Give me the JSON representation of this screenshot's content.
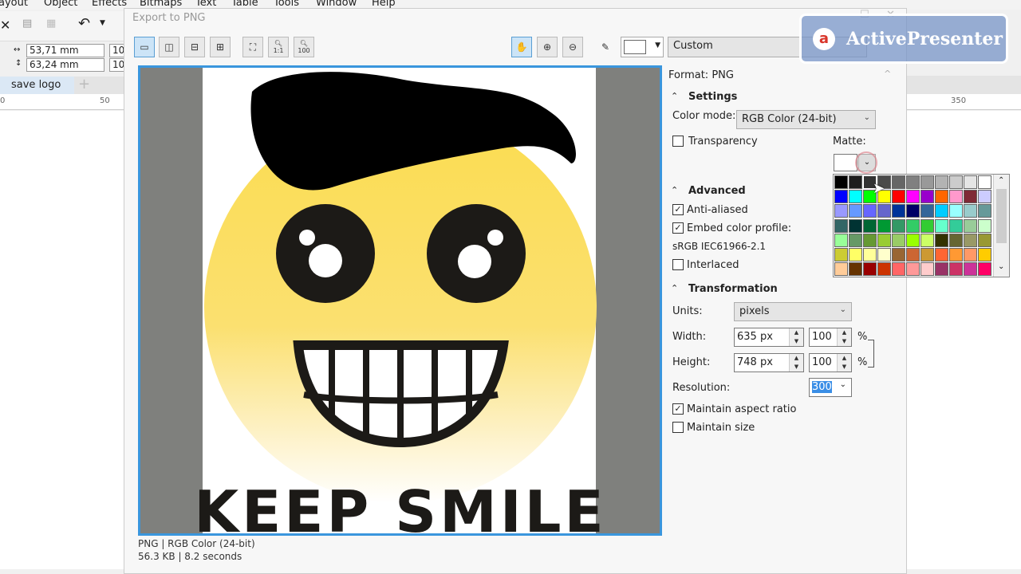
{
  "app_menu": [
    "ayout",
    "Object",
    "Effects",
    "Bitmaps",
    "Text",
    "Table",
    "Tools",
    "Window",
    "Help"
  ],
  "property_bar": {
    "width": "53,71 mm",
    "height": "63,24 mm",
    "scale_x": "10",
    "scale_y": "10"
  },
  "document_tab": "save logo",
  "ruler": {
    "left_labels": [
      "0",
      "50"
    ],
    "right_label": "350"
  },
  "dialog": {
    "title": "Export to PNG",
    "preset": "Custom",
    "status_line1": "PNG  |  RGB Color (24-bit)",
    "status_line2": "56.3 KB  |  8.2 seconds",
    "zoom_labels": {
      "one_to_one": "1:1",
      "hundred": "100"
    }
  },
  "artwork": {
    "caption": "KEEP SMILE"
  },
  "panel": {
    "format": "Format:  PNG",
    "settings": {
      "title": "Settings",
      "color_mode_label": "Color mode:",
      "color_mode": "RGB Color (24-bit)",
      "transparency_label": "Transparency",
      "transparency": false,
      "matte_label": "Matte:"
    },
    "advanced": {
      "title": "Advanced",
      "anti_aliased_label": "Anti-aliased",
      "anti_aliased": true,
      "embed_label": "Embed color profile:",
      "embed": true,
      "profile": "sRGB IEC61966-2.1",
      "interlaced_label": "Interlaced",
      "interlaced": false
    },
    "transformation": {
      "title": "Transformation",
      "units_label": "Units:",
      "units": "pixels",
      "width_label": "Width:",
      "width": "635 px",
      "width_pct": "100",
      "height_label": "Height:",
      "height": "748 px",
      "height_pct": "100",
      "pct": "%",
      "resolution_label": "Resolution:",
      "resolution": "300",
      "aspect_label": "Maintain aspect ratio",
      "aspect": true,
      "size_label": "Maintain size",
      "size": false
    }
  },
  "palette_colors": [
    [
      "#000000",
      "#1e1e1e",
      "#333333",
      "#4a4a4a",
      "#666666",
      "#808080",
      "#999999",
      "#b3b3b3",
      "#cccccc",
      "#e5e5e5",
      "#ffffff"
    ],
    [
      "#0000ff",
      "#00ffff",
      "#00ff00",
      "#ffff00",
      "#ff0000",
      "#ff00ff",
      "#9900cc",
      "#ff6600",
      "#ff99cc",
      "#7f2a36",
      "#ccccff"
    ],
    [
      "#9999ff",
      "#6699ff",
      "#6666ff",
      "#6666cc",
      "#003399",
      "#000066",
      "#336699",
      "#00ccff",
      "#99ffff",
      "#99cccc",
      "#669999"
    ],
    [
      "#336666",
      "#003333",
      "#006633",
      "#009933",
      "#339966",
      "#33cc66",
      "#33cc33",
      "#66ffcc",
      "#33cc99",
      "#99cc99",
      "#ccffcc"
    ],
    [
      "#99ff99",
      "#669966",
      "#669933",
      "#99cc33",
      "#99cc66",
      "#99ff00",
      "#ccff66",
      "#333300",
      "#666633",
      "#999966",
      "#999933"
    ],
    [
      "#cccc33",
      "#ffff66",
      "#ffff99",
      "#ffffcc",
      "#996633",
      "#cc6633",
      "#cc9933",
      "#ff6633",
      "#ff9933",
      "#ff9966",
      "#ffcc00"
    ],
    [
      "#ffcc99",
      "#663300",
      "#990000",
      "#cc3300",
      "#ff6666",
      "#ff9999",
      "#ffcccc",
      "#993366",
      "#cc3366",
      "#cc3399",
      "#ff0066"
    ]
  ],
  "watermark": "ActivePresenter",
  "colors": {
    "accent": "#3a96dd",
    "preview_gray": "#7f807d",
    "face": "#fbdf5c"
  }
}
